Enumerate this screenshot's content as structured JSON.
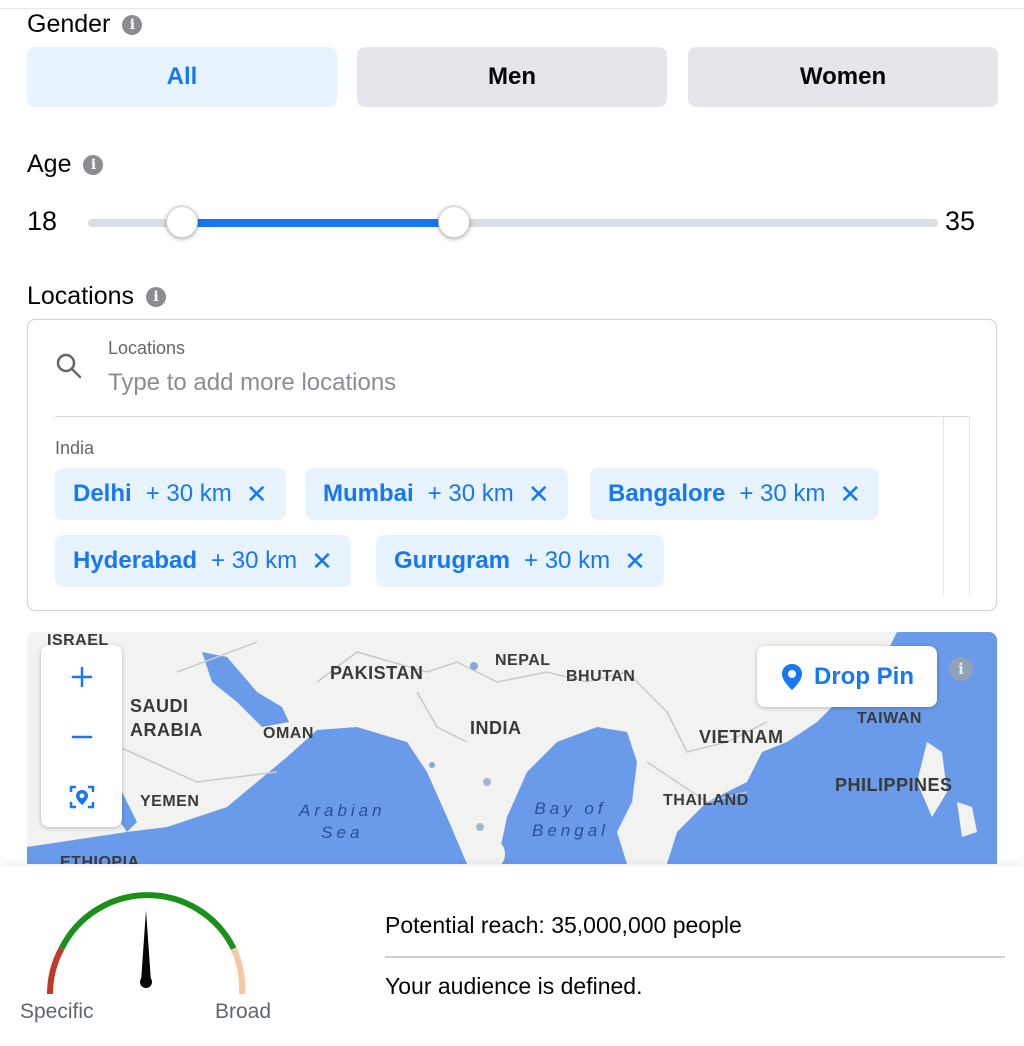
{
  "gender": {
    "label": "Gender",
    "options": [
      "All",
      "Men",
      "Women"
    ],
    "selected": "All"
  },
  "age": {
    "label": "Age",
    "min_label": "18",
    "max_label": "35",
    "range_low_fraction": 0.11,
    "range_high_fraction": 0.43
  },
  "locations": {
    "label": "Locations",
    "field_label": "Locations",
    "placeholder": "Type to add more locations",
    "country": "India",
    "chips": [
      {
        "city": "Delhi",
        "radius": "+ 30 km"
      },
      {
        "city": "Mumbai",
        "radius": "+ 30 km"
      },
      {
        "city": "Bangalore",
        "radius": "+ 30 km"
      },
      {
        "city": "Hyderabad",
        "radius": "+ 30 km"
      },
      {
        "city": "Gurugram",
        "radius": "+ 30 km"
      }
    ]
  },
  "map": {
    "drop_pin_label": "Drop Pin",
    "labels": {
      "israel": "ISRAEL",
      "pakistan": "PAKISTAN",
      "nepal": "NEPAL",
      "bhutan": "BHUTAN",
      "saudi": "SAUDI\nARABIA",
      "oman": "OMAN",
      "india": "INDIA",
      "vietnam": "VIETNAM",
      "taiwan": "TAIWAN",
      "yemen": "YEMEN",
      "thailand": "THAILAND",
      "philippines": "PHILIPPINES",
      "arabian_sea": "Arabian\nSea",
      "bay_of_bengal": "Bay of\nBengal",
      "ethiopia": "ETHIOPIA"
    },
    "colors": {
      "water": "#6a9bea",
      "land": "#f2f3f0"
    }
  },
  "gauge": {
    "specific_label": "Specific",
    "broad_label": "Broad",
    "colors": {
      "specific": "#c0392b",
      "good": "#1a8f1a",
      "broad": "#f5c6a0"
    }
  },
  "reach": {
    "potential_text": "Potential reach: 35,000,000 people",
    "status_text": "Your audience is defined."
  }
}
